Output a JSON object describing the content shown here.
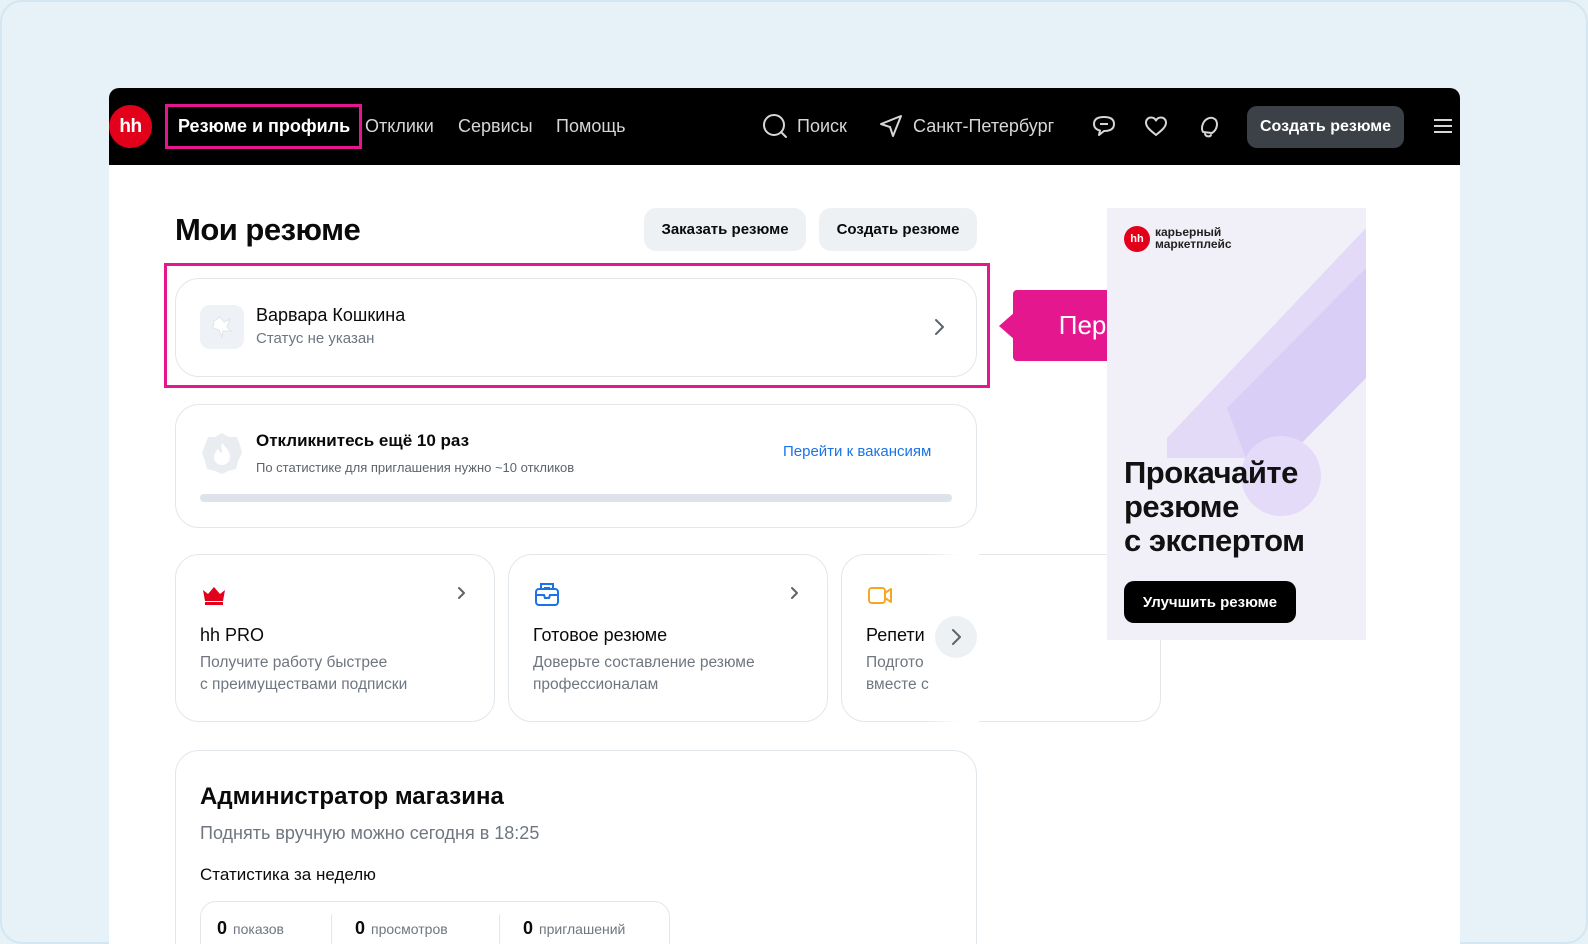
{
  "nav": {
    "logo": "hh",
    "active_item": "Резюме и профиль",
    "items": [
      "Отклики",
      "Сервисы",
      "Помощь"
    ],
    "search_label": "Поиск",
    "city_label": "Санкт-Петербург",
    "create_button": "Создать резюме"
  },
  "main": {
    "title": "Мои резюме",
    "order_button": "Заказать резюме",
    "create_button": "Создать резюме",
    "profile": {
      "name": "Варвара Кошкина",
      "status": "Статус не указан"
    },
    "callout": "Перейти к профилю",
    "responses": {
      "title": "Откликнитесь ещё 10 раз",
      "subtitle": "По статистике для приглашения нужно ~10 откликов",
      "link": "Перейти к вакансиям",
      "progress": 0
    },
    "services": [
      {
        "title": "hh PRO",
        "desc_line1": "Получите работу быстрее",
        "desc_line2": "с преимуществами подписки",
        "icon": "crown-icon",
        "color": "#e3001b"
      },
      {
        "title": "Готовое резюме",
        "desc_line1": "Доверьте составление резюме",
        "desc_line2": "профессионалам",
        "icon": "resume-inbox-icon",
        "color": "#1a73e8"
      },
      {
        "title": "Репети",
        "desc_line1": "Подгото",
        "desc_line2": "вместе с",
        "icon": "video-camera-icon",
        "color": "#f5a623"
      }
    ],
    "vacancy_resume": {
      "title": "Администратор магазина",
      "subtitle": "Поднять вручную можно сегодня в 18:25",
      "stats_heading": "Статистика за неделю",
      "stats": [
        {
          "value": "0",
          "label": "показов"
        },
        {
          "value": "0",
          "label": "просмотров"
        },
        {
          "value": "0",
          "label": "приглашений"
        }
      ]
    }
  },
  "ad": {
    "logo": "hh",
    "brand_line1": "карьерный",
    "brand_line2": "маркетплейс",
    "headline_line1": "Прокачайте",
    "headline_line2": "резюме",
    "headline_line3": "с экспертом",
    "button": "Улучшить резюме"
  }
}
